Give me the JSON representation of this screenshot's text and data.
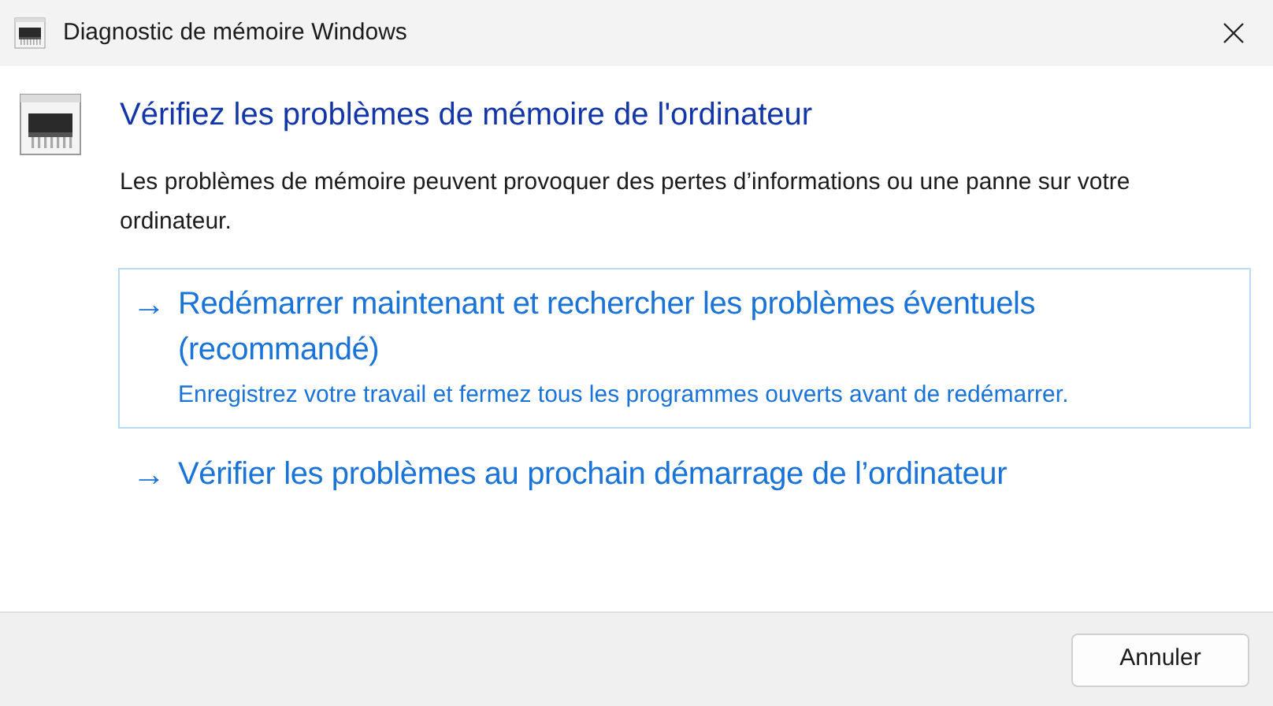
{
  "window": {
    "title": "Diagnostic de mémoire Windows"
  },
  "heading": "Vérifiez les problèmes de mémoire de l'ordinateur",
  "description": "Les problèmes de mémoire peuvent provoquer des pertes d’informations ou une panne sur votre ordinateur.",
  "options": [
    {
      "arrow": "→",
      "title": "Redémarrer maintenant et rechercher les problèmes éventuels (recommandé)",
      "subtitle": "Enregistrez votre travail et fermez tous les programmes ouverts avant de redémarrer.",
      "selected": true
    },
    {
      "arrow": "→",
      "title": "Vérifier les problèmes au prochain démarrage de l’ordinateur",
      "selected": false
    }
  ],
  "buttons": [
    "Annuler"
  ]
}
